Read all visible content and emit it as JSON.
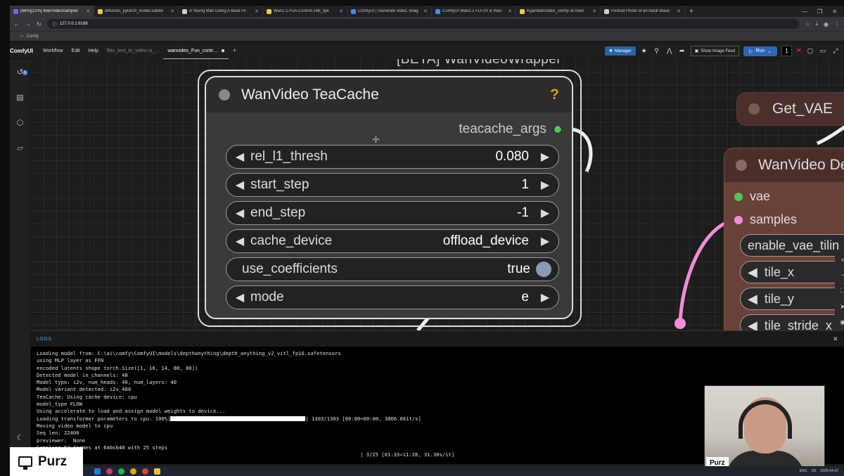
{
  "browser": {
    "tabs": [
      {
        "label": "[68%][12%] WanVideoSampler",
        "color": "#7a5cff"
      },
      {
        "label": "diffusion_pytorch_model.safete",
        "color": "#f2c94c"
      },
      {
        "label": "A Young Man Doing A Back Fli",
        "color": "#cccccc"
      },
      {
        "label": "Wan2.1-Fun-Control-14B_fp8",
        "color": "#f2c94c"
      },
      {
        "label": "ComfyUI | Generate video, imag",
        "color": "#4a8be8"
      },
      {
        "label": "ComfyUI Wan2.1 FLF2V & Wan",
        "color": "#4a8be8"
      },
      {
        "label": "Kijai/WanVideo_comfy at main",
        "color": "#f2c94c"
      },
      {
        "label": "Portrait Photo of an Adult Black",
        "color": "#cccccc"
      }
    ],
    "url": "127.0.0.1:8188",
    "bookmark": "Comfy"
  },
  "menubar": {
    "logo": "ComfyUI",
    "items": [
      "Workflow",
      "Edit",
      "Help"
    ],
    "workflow_tabs": [
      "fbtv_text_to_video-ui_...",
      "wanvideo_Fun_contr..."
    ],
    "manager": "Manager",
    "show_feed": "Show Image Feed",
    "run": "Run",
    "run_count": "1"
  },
  "sidebar": {
    "badge": "1"
  },
  "canvas": {
    "group_title": "[BETA] WanVideoWrapper",
    "teacache_node": {
      "title": "WanVideo TeaCache",
      "help": "?",
      "output": "teacache_args",
      "widgets": [
        {
          "label": "rel_l1_thresh",
          "value": "0.080"
        },
        {
          "label": "start_step",
          "value": "1"
        },
        {
          "label": "end_step",
          "value": "-1"
        },
        {
          "label": "cache_device",
          "value": "offload_device"
        },
        {
          "label": "use_coefficients",
          "value": "true"
        },
        {
          "label": "mode",
          "value": "e"
        }
      ]
    },
    "get_vae": {
      "title": "Get_VAE"
    },
    "decode_node": {
      "title": "WanVideo De",
      "inputs": [
        "vae",
        "samples"
      ],
      "widgets": [
        "enable_vae_tilin",
        "tile_x",
        "tile_y",
        "tile_stride_x"
      ]
    },
    "zoom_controls": [
      "+",
      "−",
      "⛶",
      "➤",
      "◉"
    ]
  },
  "logs": {
    "title": "LOGS",
    "lines": [
      "Loading model from: C:\\ai\\comfy\\ComfyUI\\models\\depthanything\\depth_anything_v2_vitl_fp16.safetensors",
      "using MLP layer as FFN",
      "encoded latents shape torch.Size([1, 16, 14, 80, 80])",
      "Detected model in_channels: 48",
      "Model type: i2v, num_heads: 40, num_layers: 40",
      "Model variant detected: i2v_480",
      "TeaCache: Using cache device: cpu",
      "model_type FLOW",
      "Using accelerate to load and assign model weights to device...",
      "Moving video model to cpu",
      "Seq len: 22400",
      "previewer:  None",
      "Sampling 53 frames at 640x640 with 25 steps"
    ],
    "progress_prefix": "Loading transformer parameters to cpu: 100%|",
    "progress_suffix": "| 1303/1303 [00:00<00:00, 3866.06it/s]",
    "sampling_progress": "| 3/25 [01:33<11:28, 31.30s/it]"
  },
  "overlay": {
    "brand": "Purz",
    "cam_tag": "Purz"
  },
  "taskbar": {
    "tray": [
      "ENG",
      "US",
      "2025-04-22"
    ]
  }
}
